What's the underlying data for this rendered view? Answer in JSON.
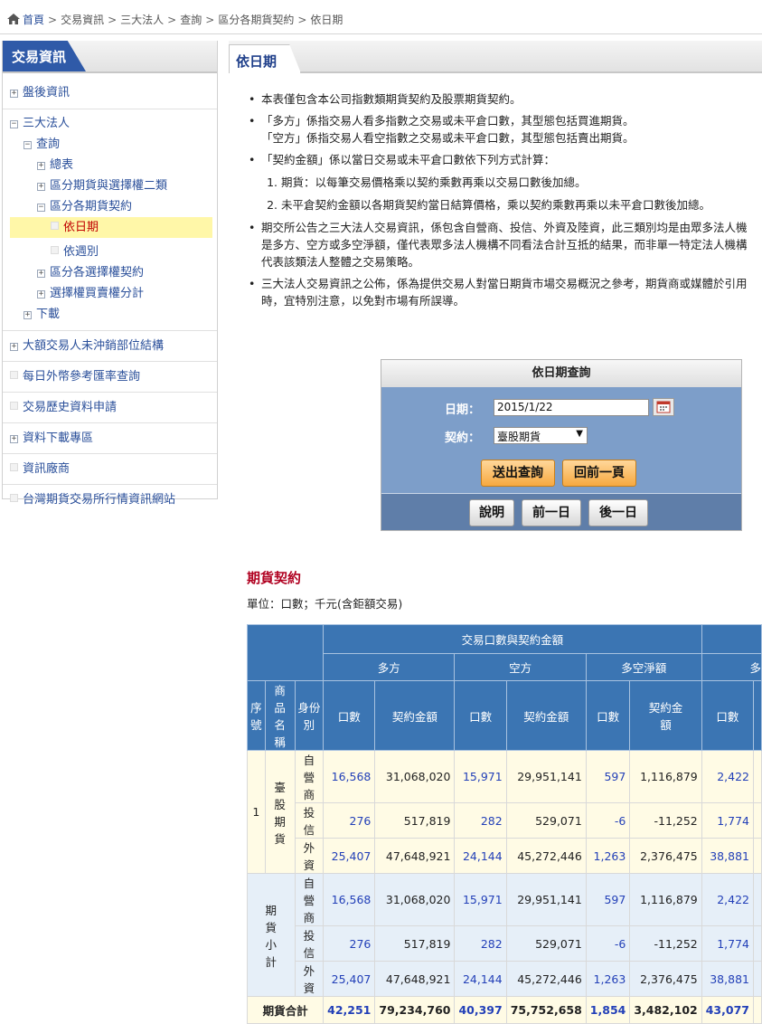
{
  "breadcrumb": [
    "首頁",
    "交易資訊",
    "三大法人",
    "查詢",
    "區分各期貨契約",
    "依日期"
  ],
  "sidebar": {
    "header": "交易資訊",
    "items": {
      "s1": "盤後資訊",
      "s2": "三大法人",
      "s2a": "查詢",
      "s2a1": "總表",
      "s2a2": "區分期貨與選擇權二類",
      "s2a3": "區分各期貨契約",
      "s2a3a": "依日期",
      "s2a3b": "依週別",
      "s2a4": "區分各選擇權契約",
      "s2a5": "選擇權買賣權分計",
      "s2b": "下載",
      "s3": "大額交易人未沖銷部位結構",
      "s4": "每日外幣參考匯率查詢",
      "s5": "交易歷史資料申請",
      "s6": "資料下載專區",
      "s7": "資訊廠商",
      "s8": "台灣期貨交易所行情資訊網站"
    }
  },
  "main": {
    "title": "依日期",
    "notes": {
      "n1": "本表僅包含本公司指數類期貨契約及股票期貨契約。",
      "n2a": "「多方」係指交易人看多指數之交易或未平倉口數，其型態包括買進期貨。",
      "n2b": "「空方」係指交易人看空指數之交易或未平倉口數，其型態包括賣出期貨。",
      "n3": "「契約金額」係以當日交易或未平倉口數依下列方式計算：",
      "n3i": "期貨：以每筆交易價格乘以契約乘數再乘以交易口數後加總。",
      "n3ii": "未平倉契約金額以各期貨契約當日結算價格，乘以契約乘數再乘以未平倉口數後加總。",
      "n4a": "期交所公告之三大法人交易資訊，係包含自營商、投信、外資及陸資，此三類別均是由眾多法人機",
      "n4b": "是多方、空方或多空淨額，僅代表眾多法人機構不同看法合計互抵的結果，而非單一特定法人機構",
      "n4c": "代表該類法人整體之交易策略。",
      "n5a": "三大法人交易資訊之公佈，係為提供交易人對當日期貨市場交易概況之參考，期貨商或媒體於引用",
      "n5b": "時，宜特別注意，以免對市場有所誤導。"
    }
  },
  "query": {
    "title": "依日期查詢",
    "date_label": "日期：",
    "date_value": "2015/1/22",
    "contract_label": "契約：",
    "contract_value": "臺股期貨",
    "submit": "送出查詢",
    "back": "回前一頁",
    "help": "說明",
    "prev_day": "前一日",
    "next_day": "後一日"
  },
  "table": {
    "section_title": "期貨契約",
    "unit": "單位：口數；千元(含鉅額交易)",
    "h_group": "交易口數與契約金額",
    "h_long": "多方",
    "h_short": "空方",
    "h_net": "多空淨額",
    "h_next": "多",
    "h_seq": "序號",
    "h_product": "商品名稱",
    "h_identity": "身份別",
    "h_qty": "口數",
    "h_amt": "契約金額",
    "group1_seq": "1",
    "group1_name": "臺股期貨",
    "group2_name": "期貨小計",
    "total_label": "期貨合計",
    "rows": [
      {
        "id": "自營商",
        "lq": "16,568",
        "la": "31,068,020",
        "sq": "15,971",
        "sa": "29,951,141",
        "nq": "597",
        "na": "1,116,879",
        "xq": "2,422"
      },
      {
        "id": "投信",
        "lq": "276",
        "la": "517,819",
        "sq": "282",
        "sa": "529,071",
        "nq": "-6",
        "na": "-11,252",
        "xq": "1,774"
      },
      {
        "id": "外資",
        "lq": "25,407",
        "la": "47,648,921",
        "sq": "24,144",
        "sa": "45,272,446",
        "nq": "1,263",
        "na": "2,376,475",
        "xq": "38,881"
      },
      {
        "id": "自營商",
        "lq": "16,568",
        "la": "31,068,020",
        "sq": "15,971",
        "sa": "29,951,141",
        "nq": "597",
        "na": "1,116,879",
        "xq": "2,422"
      },
      {
        "id": "投信",
        "lq": "276",
        "la": "517,819",
        "sq": "282",
        "sa": "529,071",
        "nq": "-6",
        "na": "-11,252",
        "xq": "1,774"
      },
      {
        "id": "外資",
        "lq": "25,407",
        "la": "47,648,921",
        "sq": "24,144",
        "sa": "45,272,446",
        "nq": "1,263",
        "na": "2,376,475",
        "xq": "38,881"
      }
    ],
    "total": {
      "lq": "42,251",
      "la": "79,234,760",
      "sq": "40,397",
      "sa": "75,752,658",
      "nq": "1,854",
      "na": "3,482,102",
      "xq": "43,077"
    }
  }
}
